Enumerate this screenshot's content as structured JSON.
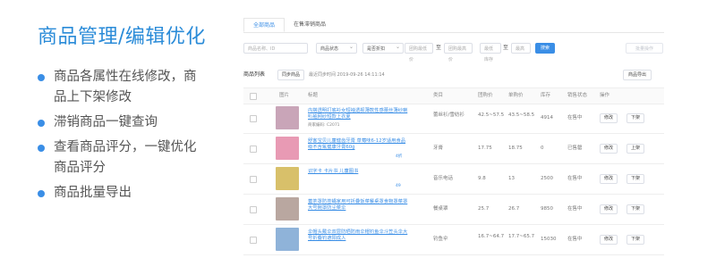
{
  "heading": "商品管理/编辑优化",
  "features": [
    {
      "line1": "商品各属性在线修改，商",
      "line2": "品上下架修改"
    },
    {
      "line1": "滞销商品一键查询",
      "line2": ""
    },
    {
      "line1": "查看商品评分，一键优化",
      "line2": "商品评分"
    },
    {
      "line1": "商品批量导出",
      "line2": ""
    }
  ],
  "tabs": [
    "全部商品",
    "在售滞销商品"
  ],
  "filters": {
    "name_placeholder": "商品名称、ID",
    "status_select": "商品状态",
    "discount_select": "是否折扣",
    "price_min_placeholder": "团购最低价",
    "to": "至",
    "price_max_placeholder": "团购最高价",
    "stock_min_placeholder": "最低库存",
    "stock_max_placeholder": "最高",
    "search_label": "搜索",
    "batch_label": "批量操作"
  },
  "list": {
    "label": "商品列表",
    "sync_label": "同步商品",
    "sync_time": "最近同步时间 2019-09-26 14:11:14",
    "export_label": "商品导出"
  },
  "columns": [
    "图片",
    "标题",
    "类目",
    "团购价",
    "单购价",
    "库存",
    "销售状态",
    "操作"
  ],
  "rows": [
    {
      "title": "内搭透明打底衫女短袖透视薄款性感蕾丝薄纱喇叭袖网纱短款上衣夏",
      "code": "商家编码: C2071",
      "count": "",
      "category": "蕾丝衫/雪纺衫",
      "group_price": "42.5~57.5",
      "single_price": "43.5~58.5",
      "stock": "4914",
      "status": "在售中",
      "op1": "修改",
      "op2": "下架",
      "thumb_color": "#c9a5b8"
    },
    {
      "title": "舒客宝贝儿童健齿牙膏 草莓味6-12岁适用食品级不含氟健康牙膏60g",
      "code": "",
      "count": "4折",
      "category": "牙膏",
      "group_price": "17.75",
      "single_price": "18.75",
      "stock": "0",
      "status": "已售罄",
      "op1": "修改",
      "op2": "上架",
      "thumb_color": "#e89ab4"
    },
    {
      "title": "识字卡 卡片书 儿童图书",
      "code": "",
      "count": "49",
      "category": "音乐电话",
      "group_price": "9.8",
      "single_price": "13",
      "stock": "2500",
      "status": "在售中",
      "op1": "修改",
      "op2": "下架",
      "thumb_color": "#d8c06a"
    },
    {
      "title": "蓋茶罩防苍蝇家用可折叠饭菜餐桌罩食物罩菜罩大号碗罩防尘菜伞",
      "code": "",
      "count": "",
      "category": "餐桌罩",
      "group_price": "25.7",
      "single_price": "26.7",
      "stock": "9850",
      "status": "在售中",
      "op1": "修改",
      "op2": "下架",
      "thumb_color": "#b9a7a0"
    },
    {
      "title": "伞帽头戴伞双层防晒防雨伞帽钓鱼伞斗笠头伞大号折叠钓遮阳成人",
      "code": "",
      "count": "",
      "category": "钓鱼伞",
      "group_price": "16.7~64.7",
      "single_price": "17.7~65.7",
      "stock": "15030",
      "status": "在售中",
      "op1": "修改",
      "op2": "下架",
      "thumb_color": "#8fb3d9"
    }
  ]
}
